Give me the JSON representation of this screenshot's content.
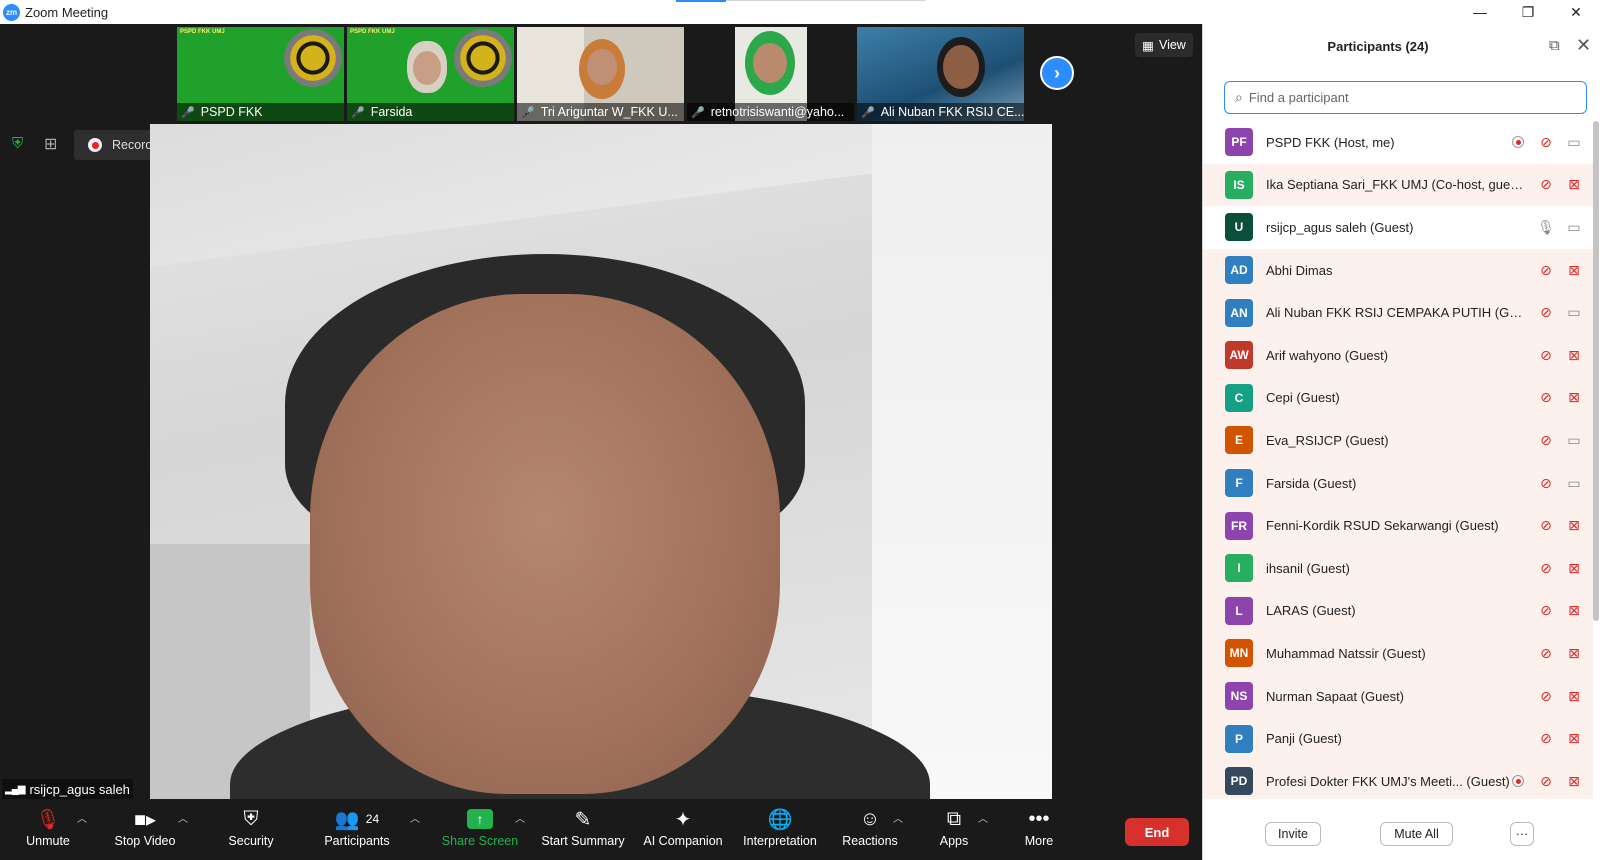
{
  "window": {
    "title": "Zoom Meeting",
    "logo_text": "zm",
    "controls": [
      "—",
      "❐",
      "✕"
    ]
  },
  "strip": {
    "tiles": [
      {
        "name": "PSPD FKK",
        "kind": "green",
        "banner": "PSPD FKK UMJ"
      },
      {
        "name": "Farsida",
        "kind": "green-face",
        "banner": "PSPD FKK UMJ"
      },
      {
        "name": "Tri Ariguntar W_FKK U...",
        "kind": "office"
      },
      {
        "name": "retnotrisiswanti@yaho...",
        "kind": "green-hijab"
      },
      {
        "name": "Ali Nuban FKK RSIJ CE...",
        "kind": "reef"
      }
    ],
    "view_label": "View"
  },
  "recording": {
    "label": "Recording..."
  },
  "active_speaker": {
    "name": "rsijcp_agus saleh"
  },
  "toolbar": {
    "unmute": "Unmute",
    "stop_video": "Stop Video",
    "security": "Security",
    "participants": "Participants",
    "participants_count": "24",
    "share_screen": "Share Screen",
    "start_summary": "Start Summary",
    "ai_companion": "AI Companion",
    "interpretation": "Interpretation",
    "reactions": "Reactions",
    "apps": "Apps",
    "more": "More",
    "end": "End"
  },
  "panel": {
    "title": "Participants (24)",
    "search_placeholder": "Find a participant",
    "invite": "Invite",
    "mute_all": "Mute All",
    "more": "···",
    "participants": [
      {
        "initials": "PF",
        "color": "#8e44ad",
        "name": "PSPD FKK (Host, me)",
        "mic": "muted",
        "video": "on",
        "recording": true,
        "highlight": false
      },
      {
        "initials": "IS",
        "color": "#27ae60",
        "name": "Ika Septiana Sari_FKK UMJ (Co-host, guest)",
        "mic": "muted",
        "video": "off",
        "recording": false,
        "highlight": true
      },
      {
        "initials": "U",
        "color": "#0b4f3a",
        "name": "rsijcp_agus saleh (Guest)",
        "mic": "on",
        "video": "on",
        "recording": false,
        "highlight": false
      },
      {
        "initials": "AD",
        "color": "#2f7fc1",
        "name": "Abhi Dimas",
        "mic": "muted",
        "video": "off",
        "recording": false,
        "highlight": true
      },
      {
        "initials": "AN",
        "color": "#2f7fc1",
        "name": "Ali Nuban FKK RSIJ CEMPAKA PUTIH (Guest)",
        "mic": "muted",
        "video": "on",
        "recording": false,
        "highlight": true
      },
      {
        "initials": "AW",
        "color": "#c0392b",
        "name": "Arif wahyono (Guest)",
        "mic": "muted",
        "video": "off",
        "recording": false,
        "highlight": true
      },
      {
        "initials": "C",
        "color": "#16a085",
        "name": "Cepi (Guest)",
        "mic": "muted",
        "video": "off",
        "recording": false,
        "highlight": true
      },
      {
        "initials": "E",
        "color": "#d35400",
        "name": "Eva_RSIJCP (Guest)",
        "mic": "muted",
        "video": "on",
        "recording": false,
        "highlight": true
      },
      {
        "initials": "F",
        "color": "#2f7fc1",
        "name": "Farsida (Guest)",
        "mic": "muted",
        "video": "on",
        "recording": false,
        "highlight": true
      },
      {
        "initials": "FR",
        "color": "#8e44ad",
        "name": "Fenni-Kordik RSUD Sekarwangi (Guest)",
        "mic": "muted",
        "video": "off",
        "recording": false,
        "highlight": true
      },
      {
        "initials": "I",
        "color": "#27ae60",
        "name": "ihsanil (Guest)",
        "mic": "muted",
        "video": "off",
        "recording": false,
        "highlight": true
      },
      {
        "initials": "L",
        "color": "#8e44ad",
        "name": "LARAS (Guest)",
        "mic": "muted",
        "video": "off",
        "recording": false,
        "highlight": true
      },
      {
        "initials": "MN",
        "color": "#d35400",
        "name": "Muhammad Natssir (Guest)",
        "mic": "muted",
        "video": "off",
        "recording": false,
        "highlight": true
      },
      {
        "initials": "NS",
        "color": "#8e44ad",
        "name": "Nurman Sapaat (Guest)",
        "mic": "muted",
        "video": "off",
        "recording": false,
        "highlight": true
      },
      {
        "initials": "P",
        "color": "#2f7fc1",
        "name": "Panji (Guest)",
        "mic": "muted",
        "video": "off",
        "recording": false,
        "highlight": true
      },
      {
        "initials": "PD",
        "color": "#34495e",
        "name": "Profesi Dokter FKK UMJ's Meeti...  (Guest)",
        "mic": "muted",
        "video": "off",
        "recording": true,
        "highlight": true
      }
    ]
  }
}
